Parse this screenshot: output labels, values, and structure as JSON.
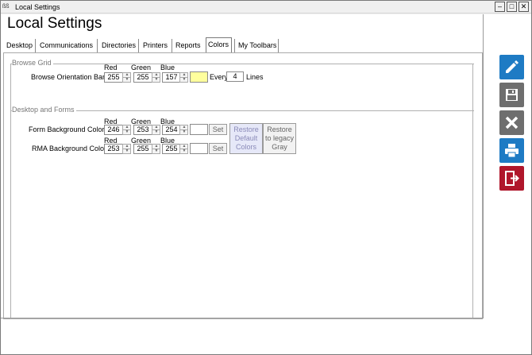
{
  "window": {
    "title": "Local Settings",
    "app_icon_text": "ßß"
  },
  "header": {
    "title": "Local Settings"
  },
  "tabs": [
    {
      "label": "Desktop"
    },
    {
      "label": "Communications"
    },
    {
      "label": "Directories"
    },
    {
      "label": "Printers"
    },
    {
      "label": "Reports"
    },
    {
      "label": "Colors"
    },
    {
      "label": "My Toolbars"
    }
  ],
  "browse_grid": {
    "section_title": "Browse Grid",
    "col_red": "Red",
    "col_green": "Green",
    "col_blue": "Blue",
    "row_label": "Browse Orientation Bar",
    "red": "255",
    "green": "255",
    "blue": "157",
    "swatch_color": "#ffff9d",
    "every_label": "Every",
    "every_value": "4",
    "lines_label": "Lines"
  },
  "desktop_forms": {
    "section_title": "Desktop and Forms",
    "form_bg": {
      "col_red": "Red",
      "col_green": "Green",
      "col_blue": "Blue",
      "label": "Form Background Color",
      "red": "246",
      "green": "253",
      "blue": "254",
      "set_label": "Set"
    },
    "rma_bg": {
      "col_red": "Red",
      "col_green": "Green",
      "col_blue": "Blue",
      "label": "RMA Background Color",
      "red": "253",
      "green": "255",
      "blue": "255",
      "set_label": "Set"
    },
    "restore_default_label": "Restore\nDefault\nColors",
    "restore_gray_label": "Restore\nto legacy\nGray"
  },
  "side_toolbar": {
    "edit": {
      "icon": "pencil-icon",
      "color": "#1e7bc4"
    },
    "save": {
      "icon": "floppy-icon",
      "color": "#6e6e6e"
    },
    "cancel": {
      "icon": "close-icon",
      "color": "#6e6e6e"
    },
    "print": {
      "icon": "printer-icon",
      "color": "#1e7bc4"
    },
    "exit": {
      "icon": "exit-icon",
      "color": "#b0162b"
    }
  }
}
